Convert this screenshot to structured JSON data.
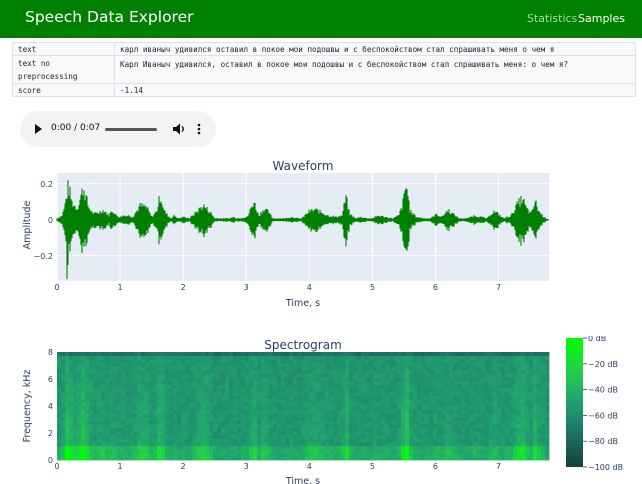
{
  "navbar": {
    "brand": "Speech Data Explorer",
    "links": [
      {
        "label": "Statistics",
        "active": false
      },
      {
        "label": "Samples",
        "active": true
      }
    ],
    "color": "#008000"
  },
  "sample_table": [
    {
      "key": "text",
      "value": "карл иваныч удивился оставил в покое мои подошвы и с беспокойством стал спрашивать меня о чем я"
    },
    {
      "key": "text no preprocessing",
      "value": "Карл Иваныч удивился, оставил в покое мои подошвы и с беспокойством стал спрашивать меня: о чем я?"
    },
    {
      "key": "score",
      "value": "-1.14"
    }
  ],
  "audio_player": {
    "time": "0:00 / 0:07",
    "icons": [
      "play-icon",
      "volume-icon",
      "more-options-icon"
    ]
  },
  "chart_data": [
    {
      "type": "line",
      "title": "Waveform",
      "xlabel": "Time, s",
      "ylabel": "Amplitude",
      "xlim": [
        0,
        7.8
      ],
      "ylim": [
        -0.34,
        0.26
      ],
      "xticks": [
        0,
        1,
        2,
        3,
        4,
        5,
        6,
        7
      ],
      "yticks": [
        0.2,
        0,
        -0.2
      ],
      "ytick_labels": [
        "0.2",
        "0",
        "−0.2"
      ],
      "grid": true,
      "color": "#008000",
      "series": [
        {
          "envelope": [
            {
              "t": 0.0,
              "a": 0.01
            },
            {
              "t": 0.08,
              "a": 0.03
            },
            {
              "t": 0.12,
              "a": 0.09
            },
            {
              "t": 0.18,
              "a": 0.24
            },
            {
              "t": 0.24,
              "a": 0.12
            },
            {
              "t": 0.32,
              "a": 0.08
            },
            {
              "t": 0.42,
              "a": 0.23
            },
            {
              "t": 0.5,
              "a": 0.09
            },
            {
              "t": 0.58,
              "a": 0.04
            },
            {
              "t": 0.65,
              "a": 0.05
            },
            {
              "t": 0.74,
              "a": 0.07
            },
            {
              "t": 0.82,
              "a": 0.03
            },
            {
              "t": 0.88,
              "a": 0.07
            },
            {
              "t": 0.94,
              "a": 0.03
            },
            {
              "t": 1.0,
              "a": 0.02
            },
            {
              "t": 1.05,
              "a": 0.03
            },
            {
              "t": 1.14,
              "a": 0.03
            },
            {
              "t": 1.2,
              "a": 0.02
            },
            {
              "t": 1.32,
              "a": 0.1
            },
            {
              "t": 1.42,
              "a": 0.09
            },
            {
              "t": 1.5,
              "a": 0.02
            },
            {
              "t": 1.58,
              "a": 0.06
            },
            {
              "t": 1.64,
              "a": 0.18
            },
            {
              "t": 1.7,
              "a": 0.06
            },
            {
              "t": 1.8,
              "a": 0.01
            },
            {
              "t": 1.86,
              "a": 0.03
            },
            {
              "t": 1.92,
              "a": 0.01
            },
            {
              "t": 2.02,
              "a": 0.02
            },
            {
              "t": 2.1,
              "a": 0.01
            },
            {
              "t": 2.22,
              "a": 0.06
            },
            {
              "t": 2.32,
              "a": 0.1
            },
            {
              "t": 2.42,
              "a": 0.06
            },
            {
              "t": 2.5,
              "a": 0.01
            },
            {
              "t": 2.62,
              "a": 0.01
            },
            {
              "t": 2.74,
              "a": 0.01
            },
            {
              "t": 2.8,
              "a": 0.02
            },
            {
              "t": 2.86,
              "a": 0.01
            },
            {
              "t": 3.02,
              "a": 0.02
            },
            {
              "t": 3.12,
              "a": 0.13
            },
            {
              "t": 3.2,
              "a": 0.03
            },
            {
              "t": 3.28,
              "a": 0.08
            },
            {
              "t": 3.36,
              "a": 0.05
            },
            {
              "t": 3.42,
              "a": 0.01
            },
            {
              "t": 3.52,
              "a": 0.01
            },
            {
              "t": 3.62,
              "a": 0.01
            },
            {
              "t": 3.72,
              "a": 0.02
            },
            {
              "t": 3.82,
              "a": 0.01
            },
            {
              "t": 3.88,
              "a": 0.01
            },
            {
              "t": 4.0,
              "a": 0.06
            },
            {
              "t": 4.1,
              "a": 0.07
            },
            {
              "t": 4.2,
              "a": 0.05
            },
            {
              "t": 4.3,
              "a": 0.03
            },
            {
              "t": 4.42,
              "a": 0.02
            },
            {
              "t": 4.52,
              "a": 0.03
            },
            {
              "t": 4.58,
              "a": 0.16
            },
            {
              "t": 4.64,
              "a": 0.04
            },
            {
              "t": 4.74,
              "a": 0.01
            },
            {
              "t": 4.82,
              "a": 0.02
            },
            {
              "t": 4.92,
              "a": 0.01
            },
            {
              "t": 5.0,
              "a": 0.01
            },
            {
              "t": 5.1,
              "a": 0.03
            },
            {
              "t": 5.2,
              "a": 0.02
            },
            {
              "t": 5.32,
              "a": 0.01
            },
            {
              "t": 5.42,
              "a": 0.03
            },
            {
              "t": 5.48,
              "a": 0.11
            },
            {
              "t": 5.54,
              "a": 0.25
            },
            {
              "t": 5.6,
              "a": 0.06
            },
            {
              "t": 5.7,
              "a": 0.02
            },
            {
              "t": 5.82,
              "a": 0.01
            },
            {
              "t": 5.92,
              "a": 0.01
            },
            {
              "t": 6.02,
              "a": 0.04
            },
            {
              "t": 6.1,
              "a": 0.02
            },
            {
              "t": 6.2,
              "a": 0.07
            },
            {
              "t": 6.28,
              "a": 0.04
            },
            {
              "t": 6.38,
              "a": 0.01
            },
            {
              "t": 6.5,
              "a": 0.01
            },
            {
              "t": 6.62,
              "a": 0.03
            },
            {
              "t": 6.72,
              "a": 0.02
            },
            {
              "t": 6.82,
              "a": 0.01
            },
            {
              "t": 6.92,
              "a": 0.06
            },
            {
              "t": 7.0,
              "a": 0.04
            },
            {
              "t": 7.08,
              "a": 0.01
            },
            {
              "t": 7.2,
              "a": 0.03
            },
            {
              "t": 7.3,
              "a": 0.11
            },
            {
              "t": 7.38,
              "a": 0.15
            },
            {
              "t": 7.44,
              "a": 0.08
            },
            {
              "t": 7.52,
              "a": 0.04
            },
            {
              "t": 7.58,
              "a": 0.13
            },
            {
              "t": 7.64,
              "a": 0.06
            },
            {
              "t": 7.72,
              "a": 0.02
            },
            {
              "t": 7.8,
              "a": 0.0
            }
          ],
          "minimum": {
            "t": 0.16,
            "a": -0.33
          }
        }
      ]
    },
    {
      "type": "heatmap",
      "title": "Spectrogram",
      "xlabel": "Time, s",
      "ylabel": "Frequency, kHz",
      "xlim": [
        0,
        7.8
      ],
      "ylim": [
        0,
        8
      ],
      "xticks": [
        0,
        1,
        2,
        3,
        4,
        5,
        6,
        7
      ],
      "yticks": [
        0,
        2,
        4,
        6,
        8
      ],
      "colorbar": {
        "range": [
          -100,
          0
        ],
        "ticks": [
          "0 dB",
          "−20 dB",
          "−40 dB",
          "−60 dB",
          "−80 dB",
          "−100 dB"
        ],
        "colors": [
          "#00ff00",
          "#23d14a",
          "#22a070",
          "#1c7066",
          "#163f3a"
        ]
      }
    }
  ]
}
